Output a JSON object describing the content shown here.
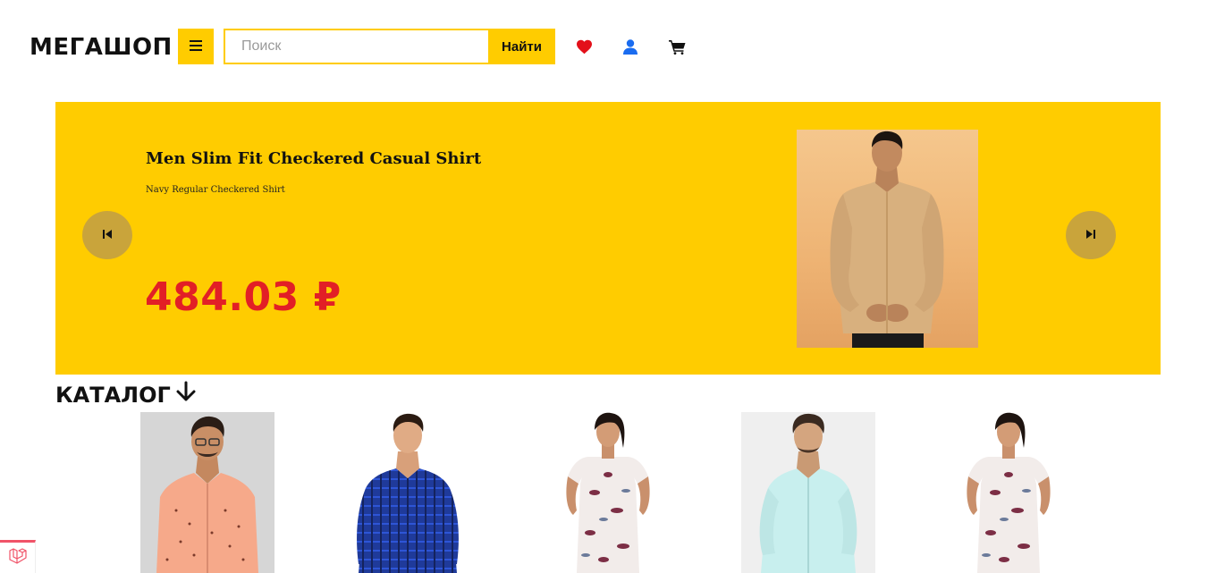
{
  "header": {
    "logo": "МЕГАШОП",
    "search_placeholder": "Поиск",
    "search_value": "",
    "search_button": "Найти",
    "icons": [
      "menu-icon",
      "heart-icon",
      "user-icon",
      "cart-icon"
    ]
  },
  "banner": {
    "title": "Men Slim Fit Checkered Casual Shirt",
    "subtitle": "Navy Regular Checkered Shirt",
    "price": "484.03 ₽",
    "icons": [
      "skip-previous-icon",
      "skip-next-icon"
    ]
  },
  "catalog": {
    "heading": "КАТАЛОГ",
    "heading_icon": "arrow-down-icon",
    "products": [
      {
        "image": "peach-printed-shirt-photo"
      },
      {
        "image": "blue-checkered-shirt-photo"
      },
      {
        "image": "floral-dress-photo"
      },
      {
        "image": "mint-shirt-photo"
      },
      {
        "image": "floral-dress-photo"
      }
    ]
  },
  "colors": {
    "accent": "#ffcc00",
    "price": "#e21f26",
    "nav_button": "#c9a43b",
    "heart": "#e3101a",
    "user": "#1a6cf0"
  }
}
